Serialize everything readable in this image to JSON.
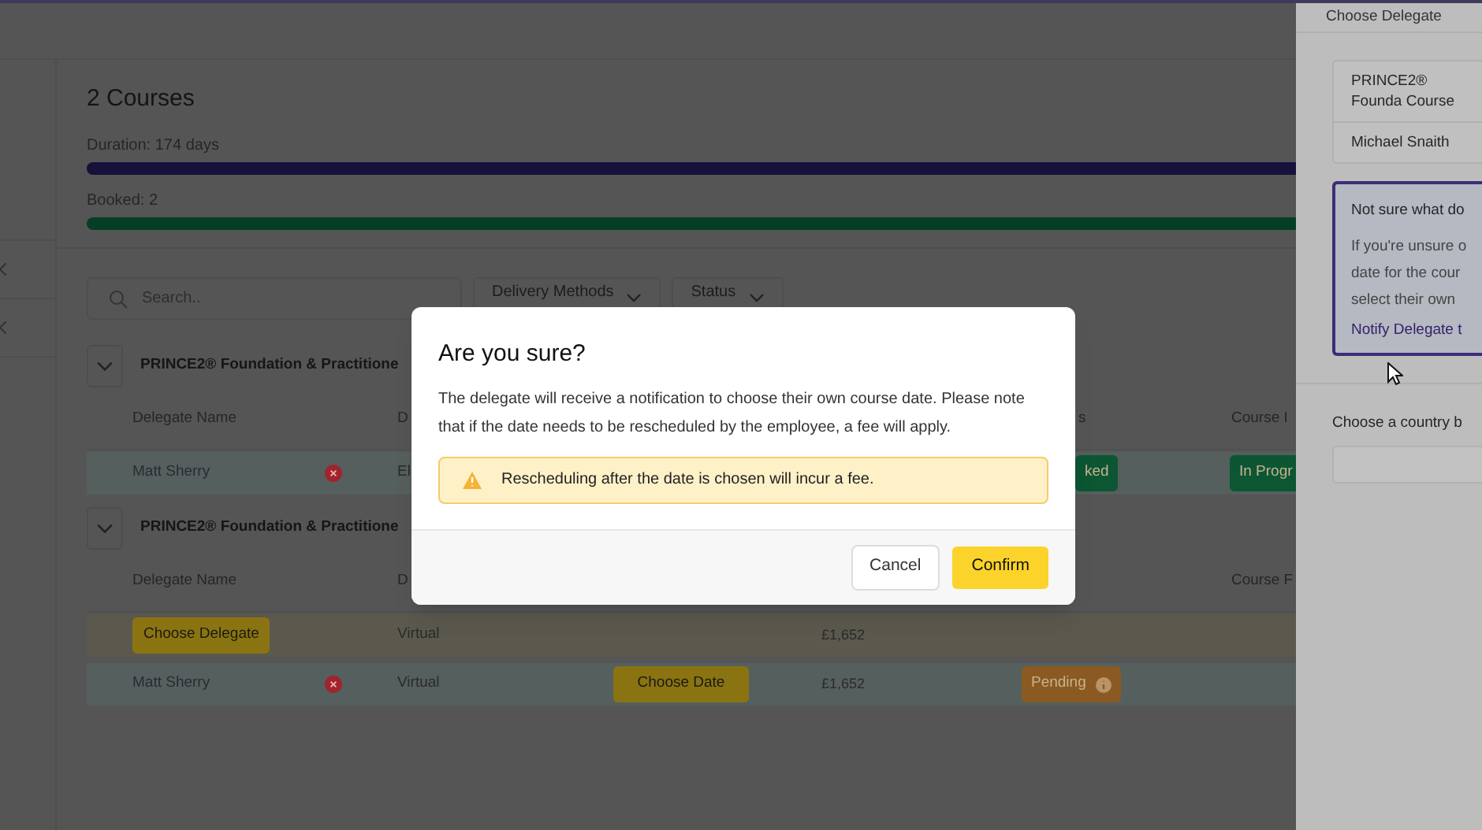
{
  "header": {
    "title": "2 Courses",
    "progress": [
      {
        "label": "Duration: 174 days",
        "level": 1,
        "color": "#16113a"
      },
      {
        "label": "Booked: 2",
        "level": 1,
        "color": "#063d25"
      }
    ]
  },
  "filters": {
    "search": {
      "placeholder": "Search.."
    },
    "dropdowns": [
      "Delivery Methods",
      "Status"
    ]
  },
  "courses": [
    {
      "title": "PRINCE2® Foundation & Practitione",
      "expanded": true,
      "headers": [
        "Delegate Name",
        "D",
        "s",
        "Course I"
      ],
      "rows": [
        {
          "kind": "assigned",
          "name": "Matt Sherry",
          "removable": true,
          "delivery": "El",
          "status": {
            "label": "ked",
            "color": "#0c5634"
          },
          "course_status": {
            "label": "In Progr",
            "color": "#0c5634"
          }
        }
      ]
    },
    {
      "title": "PRINCE2® Foundation & Practitione",
      "expanded": true,
      "headers": [
        "Delegate Name",
        "D",
        "Course F"
      ],
      "rows": [
        {
          "kind": "unassigned",
          "delegate_button": "Choose Delegate",
          "delivery": "Virtual",
          "price": "£1,652"
        },
        {
          "kind": "assigned",
          "name": "Matt Sherry",
          "removable": true,
          "delivery": "Virtual",
          "date_button": "Choose Date",
          "price": "£1,652",
          "status": {
            "label": "Pending",
            "color": "#8a5a22",
            "info": true
          }
        }
      ]
    }
  ],
  "dialog": {
    "title": "Are you sure?",
    "message": "The delegate will receive a notification to choose their own course date. Please note that if the date needs to be rescheduled by the employee, a fee will apply.",
    "warning": "Rescheduling after the date is chosen will incur a fee.",
    "buttons": [
      {
        "label": "Cancel",
        "kind": "secondary"
      },
      {
        "label": "Confirm",
        "kind": "primary"
      }
    ]
  },
  "drawer": {
    "title": "Choose Delegate",
    "summary": [
      "PRINCE2® Founda Course",
      "Michael Snaith"
    ],
    "info": {
      "heading": "Not sure what do",
      "lines": [
        "If you're unsure o",
        "date for the cour",
        "select their own"
      ],
      "link": "Notify Delegate t"
    },
    "country": {
      "label": "Choose a country b"
    }
  }
}
